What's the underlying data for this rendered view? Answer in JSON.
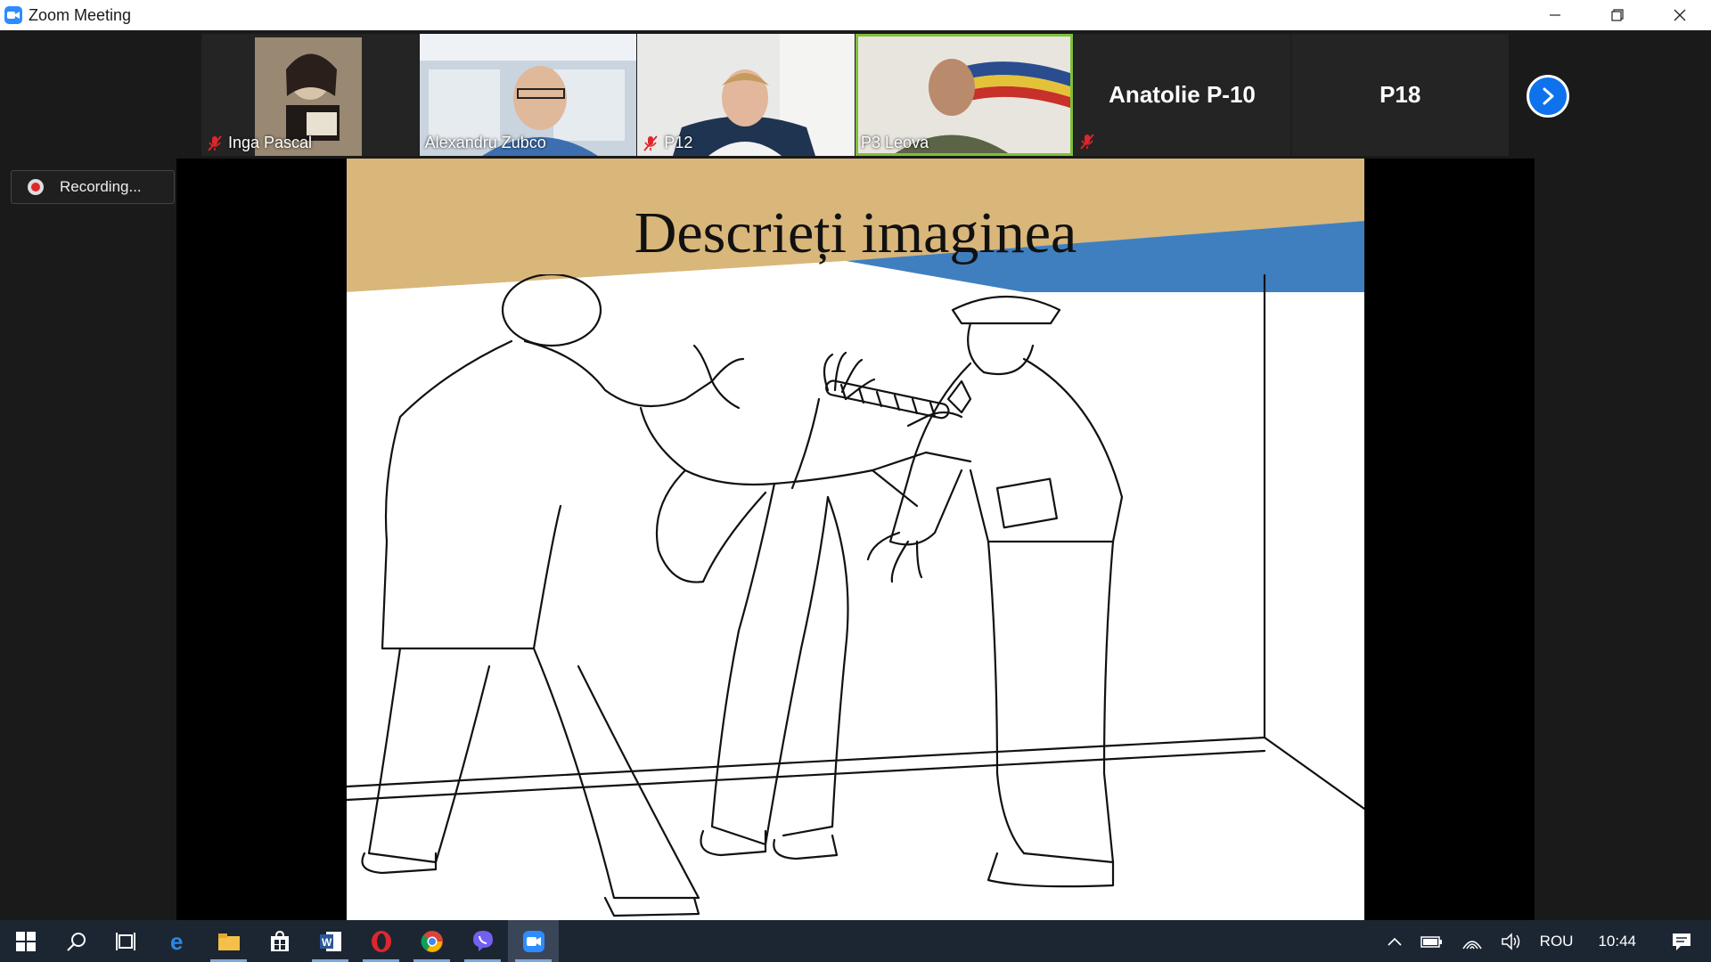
{
  "window": {
    "title": "Zoom Meeting",
    "icon": "zoom-icon"
  },
  "participants": [
    {
      "name": "Inga Pascal",
      "muted": true,
      "type": "video"
    },
    {
      "name": "Alexandru Zubco",
      "muted": false,
      "type": "video"
    },
    {
      "name": "P12",
      "muted": true,
      "type": "video"
    },
    {
      "name": "P3 Leova",
      "muted": false,
      "type": "video",
      "active_speaker": true
    },
    {
      "name": "Anatolie P-10",
      "muted": true,
      "type": "name-only"
    },
    {
      "name": "P18",
      "muted": false,
      "type": "name-only"
    }
  ],
  "recording": {
    "label": "Recording..."
  },
  "slide": {
    "title": "Descrieți imaginea"
  },
  "taskbar": {
    "apps": [
      "windows-start-icon",
      "search-icon",
      "task-view-icon",
      "edge-icon",
      "file-explorer-icon",
      "store-icon",
      "word-icon",
      "opera-icon",
      "chrome-icon",
      "viber-icon",
      "zoom-icon"
    ],
    "language": "ROU",
    "time": "10:44"
  },
  "colors": {
    "zoom_blue": "#2d8cff",
    "active_speaker": "#7fbf3a",
    "banner_tan": "#d9b67a",
    "banner_blue": "#3f7fbf",
    "mute_red": "#e0262d"
  }
}
